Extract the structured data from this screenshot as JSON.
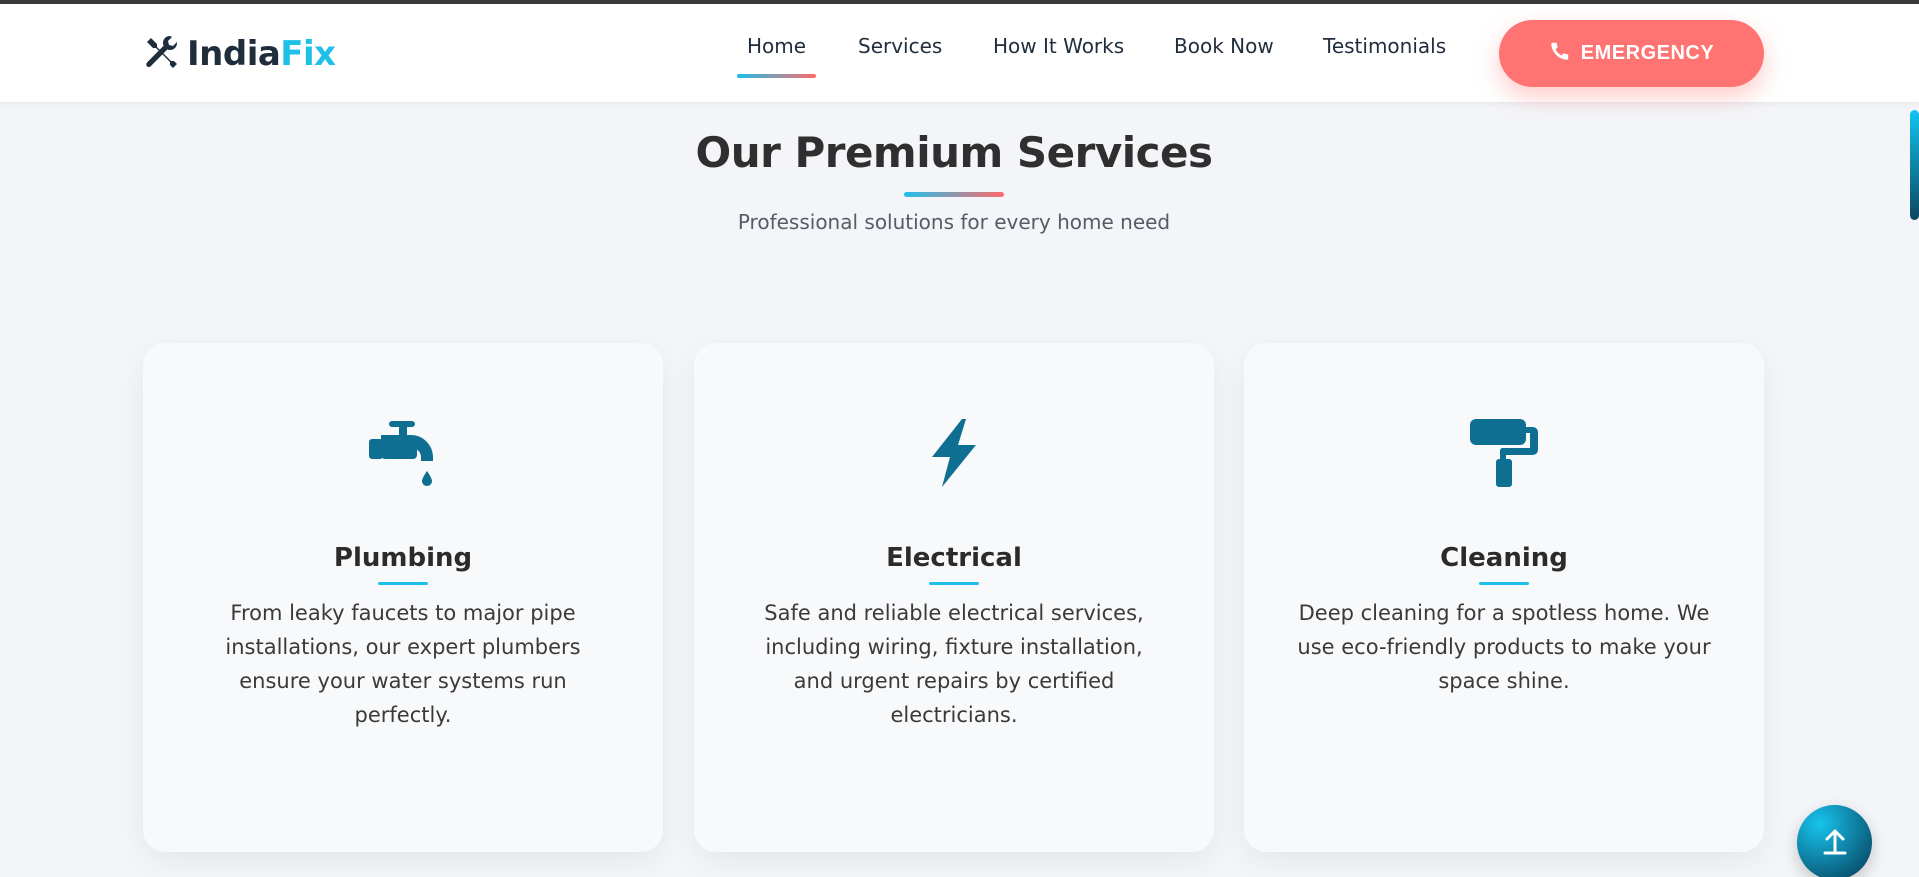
{
  "brand": {
    "name_part1": "India",
    "name_part2": "Fix",
    "logo_icon": "tools-icon"
  },
  "nav": {
    "items": [
      {
        "label": "Home",
        "active": true
      },
      {
        "label": "Services",
        "active": false
      },
      {
        "label": "How It Works",
        "active": false
      },
      {
        "label": "Book Now",
        "active": false
      },
      {
        "label": "Testimonials",
        "active": false
      }
    ],
    "emergency_label": "EMERGENCY",
    "emergency_icon": "phone-icon"
  },
  "section": {
    "title": "Our Premium Services",
    "subtitle": "Professional solutions for every home need"
  },
  "services": [
    {
      "icon": "faucet-icon",
      "title": "Plumbing",
      "description": "From leaky faucets to major pipe installations, our expert plumbers ensure your water systems run perfectly."
    },
    {
      "icon": "lightning-bolt-icon",
      "title": "Electrical",
      "description": "Safe and reliable electrical services, including wiring, fixture installation, and urgent repairs by certified electricians."
    },
    {
      "icon": "paint-roller-icon",
      "title": "Cleaning",
      "description": "Deep cleaning for a spotless home. We use eco-friendly products to make your space shine."
    }
  ],
  "colors": {
    "accent_blue": "#1ec0ea",
    "accent_coral": "#ff7373",
    "icon_blue": "#0e6f92",
    "text_dark": "#1f2d3d"
  },
  "back_to_top_icon": "arrow-up-icon"
}
